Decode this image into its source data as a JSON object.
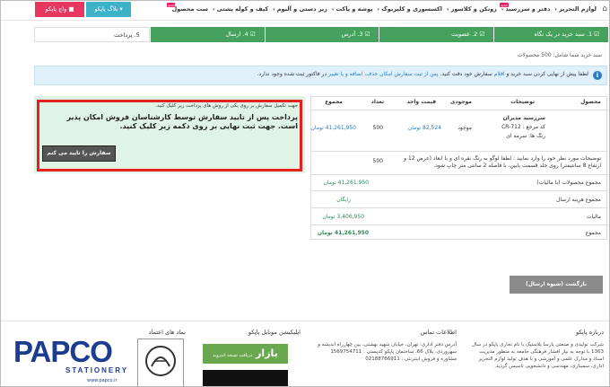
{
  "topbar": {
    "menu": [
      "لوازم التحریر",
      "دفتر و سررسید",
      "زونکن و کلاسور",
      "اکسسوری و کلیربوک",
      "پوشه و پاکت",
      "زیر دستی و آلبوم",
      "کیف و کوله پشتی",
      "ست محصول"
    ],
    "new_badge": "جدید",
    "blog_label": "بلاگ پاپکو",
    "watch_label": "واچ پاپکو"
  },
  "steps": [
    {
      "label": "1. سبد خرید در یک نگاه",
      "check": "☑"
    },
    {
      "label": "2. عضویت",
      "check": "☑"
    },
    {
      "label": "3. آدرس",
      "check": "☑"
    },
    {
      "label": "4. ارسال",
      "check": "☑"
    },
    {
      "label": "5. پرداخت",
      "check": ""
    }
  ],
  "subtitle": "سبد خرید شما شامل: 500 محصولات",
  "notice": {
    "part1": "لطفا پیش از نهایی کردن سبد خرید و ",
    "link1": "اقلام",
    "part2": " سفارش خود دقت کنید. ",
    "link2": "پس از ثبت سفارش امکان حذف، اضافه و یا تغییر",
    "part3": " در فاکتور ثبت شده وجود ندارد."
  },
  "payment": {
    "line1": "جهت تکمیل سفارش بر روی یکی از روش های پرداخت زیر کلیک کنید.",
    "big_text": "پرداخت پس از تایید سفارش توسط کارشناسان فروش امکان پذیر است. جهت ثبت نهایی بر روی دکمه زیر کلیک کنید.",
    "confirm_button": "سفارش را تایید می کنم"
  },
  "table": {
    "headers": {
      "product": "محصول",
      "description": "توضیحات",
      "availability": "موجودی",
      "unit_price": "قیمت واحد",
      "qty": "تعداد",
      "total": "مجموع"
    },
    "row": {
      "name": "سررسید مدیران",
      "code": "کد مرجع : CR-712",
      "color": "رنگ ها: سرمه ای",
      "availability": "موجود",
      "unit_price": "82,524 تومان",
      "qty": "500",
      "total": "41,261,950 تومان"
    },
    "note": "توضیحات مورد نظر خود را وارد نمایید : لطفا لوگو به رنگ نقره ای و با ابعاد (عرض 12 و ارتفاع 8 سانتیمتر) روی جلد قسمت پایین، با فاصله 2 سانتی متر چاپ شود.",
    "note_qty": "500",
    "summary": [
      {
        "label": "مجموع محصولات (با مالیات)",
        "value": "41,261,950 تومان"
      },
      {
        "label": "مجموع هزینه ارسال",
        "value": "رایگان"
      },
      {
        "label": "مالیات",
        "value": "3,406,950 تومان"
      },
      {
        "label": "مجموع",
        "value": "41,261,950 تومان"
      }
    ]
  },
  "return_button": "بازگشت (شیوه ارسال)",
  "footer": {
    "about_title": "درباره پاپکو",
    "about_text": "شرکت تولیدی و صنعتی پارسا پلاستیک با نام تجاری پاپکو در سال 1363 با توجه به نیاز افشار فرهنگی جامعه به منظور مدیریت اسناد و مدارک علمی و آموزشی و با هدف تولید لوازم التحریر اداری، سمیناری، مهندسی و دانشجویی تاسیس گردید.",
    "contact_title": "اطلاعات تماس",
    "contact_text": "آدرس دفتر اداری: تهران، خیابان شهید بهشتی، بین چهارراه اندیشه و سهروردی، پلاک 66، ساختمان پاپکو کدپستی : 1569754711",
    "contact_sales": "مشاوره و فروش اینترنتی : 02188766911",
    "app_title": "اپلیکیشن موبایل پاپکو",
    "bazaar_label": "بازار",
    "bazaar_sub": "دریافت نسخه اندروید",
    "trust_title": "نماد های اعتماد",
    "logo_word": "PAPCO",
    "logo_sub": "STATIONERY",
    "logo_url": "www.papco.ir"
  }
}
